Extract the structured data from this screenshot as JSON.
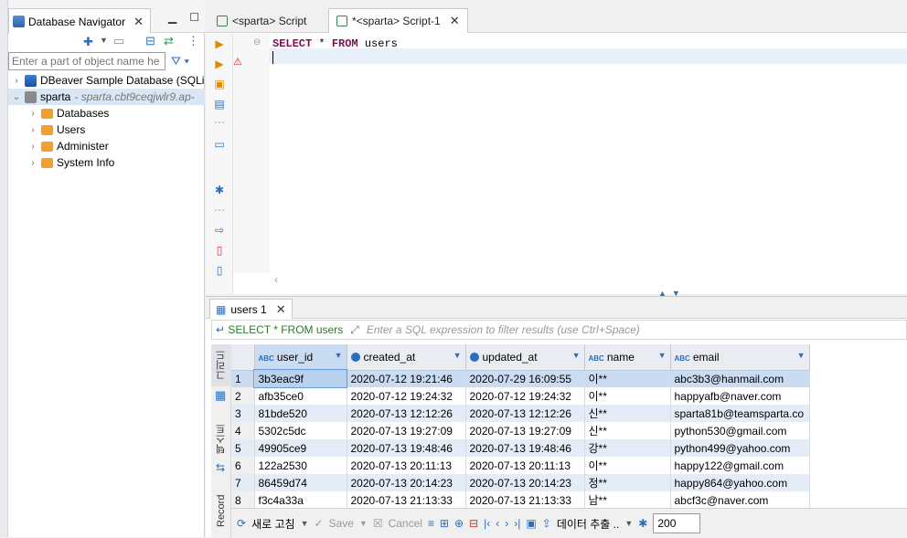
{
  "navigator": {
    "tab_title": "Database Navigator",
    "filter_placeholder": "Enter a part of object name he",
    "tree": [
      {
        "label": "DBeaver Sample Database (SQLi",
        "sub": ""
      },
      {
        "label": "sparta",
        "sub": "- sparta.cbt9ceqjwlr9.ap-"
      },
      {
        "label": "Databases"
      },
      {
        "label": "Users"
      },
      {
        "label": "Administer"
      },
      {
        "label": "System Info"
      }
    ]
  },
  "editor": {
    "tabs": [
      {
        "label": "<sparta> Script"
      },
      {
        "label": "*<sparta> Script-1"
      }
    ],
    "code_line_1_kw1": "SELECT",
    "code_line_1_mid": " * ",
    "code_line_1_kw2": "FROM",
    "code_line_1_end": " users"
  },
  "results": {
    "tab_label": "users 1",
    "query_label": "SELECT * FROM users",
    "filter_placeholder": "Enter a SQL expression to filter results (use Ctrl+Space)",
    "vtabs": [
      "그리드",
      "텍스트",
      "Record"
    ],
    "columns": [
      {
        "badge": "ABC",
        "name": "user_id"
      },
      {
        "badge": "",
        "name": "created_at"
      },
      {
        "badge": "",
        "name": "updated_at"
      },
      {
        "badge": "ABC",
        "name": "name"
      },
      {
        "badge": "ABC",
        "name": "email"
      }
    ],
    "rows": [
      [
        "1",
        "3b3eac9f",
        "2020-07-12 19:21:46",
        "2020-07-29 16:09:55",
        "이**",
        "abc3b3@hanmail.com"
      ],
      [
        "2",
        "afb35ce0",
        "2020-07-12 19:24:32",
        "2020-07-12 19:24:32",
        "이**",
        "happyafb@naver.com"
      ],
      [
        "3",
        "81bde520",
        "2020-07-13 12:12:26",
        "2020-07-13 12:12:26",
        "신**",
        "sparta81b@teamsparta.co"
      ],
      [
        "4",
        "5302c5dc",
        "2020-07-13 19:27:09",
        "2020-07-13 19:27:09",
        "신**",
        "python530@gmail.com"
      ],
      [
        "5",
        "49905ce9",
        "2020-07-13 19:48:46",
        "2020-07-13 19:48:46",
        "강**",
        "python499@yahoo.com"
      ],
      [
        "6",
        "122a2530",
        "2020-07-13 20:11:13",
        "2020-07-13 20:11:13",
        "이**",
        "happy122@gmail.com"
      ],
      [
        "7",
        "86459d74",
        "2020-07-13 20:14:23",
        "2020-07-13 20:14:23",
        "정**",
        "happy864@yahoo.com"
      ],
      [
        "8",
        "f3c4a33a",
        "2020-07-13 21:13:33",
        "2020-07-13 21:13:33",
        "남**",
        "abcf3c@naver.com"
      ]
    ],
    "bottom": {
      "refresh_label": "새로 고침",
      "save_label": "Save",
      "cancel_label": "Cancel",
      "export_label": "데이터 추출 ..",
      "fetch_size": "200"
    }
  }
}
